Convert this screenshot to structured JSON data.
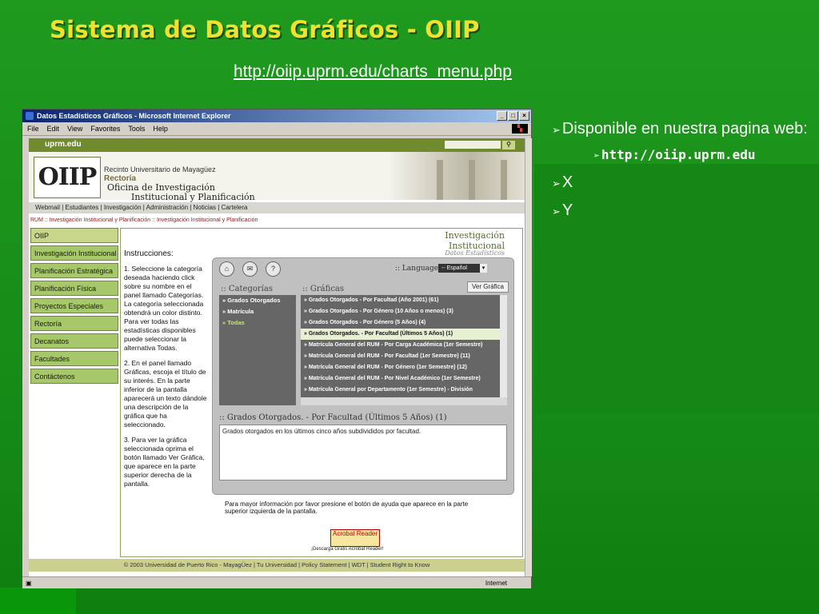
{
  "slide": {
    "title": "Sistema de Datos Gráficos - OIIP",
    "url": "http://oiip.uprm.edu/charts_menu.php",
    "bullets": {
      "item1": "Disponible en nuestra pagina web:",
      "sub1": "http://oiip.uprm.edu",
      "item2": "X",
      "item3": "Y"
    },
    "arrow_glyph": "➢"
  },
  "browser": {
    "window_title": "Datos Estadísticos Gráficos - Microsoft Internet Explorer",
    "menu": [
      "File",
      "Edit",
      "View",
      "Favorites",
      "Tools",
      "Help"
    ],
    "window_buttons": [
      "_",
      "□",
      "×"
    ],
    "status_text": "Internet"
  },
  "site": {
    "topbar_label": "uprm.edu",
    "logo_text": "OIIP",
    "header_line1": "Recinto Universitario de Mayagüez",
    "header_line2": "Rectoría",
    "header_line3": "Oficina de Investigación",
    "header_line4": "Institucional y Planificación",
    "navbar": "Webmail | Estudiantes | Investigación | Administración | Noticias | Cartelera",
    "breadcrumb": "RUM :: Investigación Institucional y Planificación :: Investigación Institucional y Planificación",
    "sidebar_items": [
      "OIIP",
      "Investigación Institucional",
      "Planificación Estratégica",
      "Planificación Física",
      "Proyectos Especiales",
      "Rectoría",
      "Decanatos",
      "Facultades",
      "Contáctenos"
    ],
    "content_header": "Investigación Institucional",
    "content_header_sub": "Datos Estadísticos",
    "instructions_title": "Instrucciones:",
    "instructions": [
      "1. Seleccione la categoría deseada haciendo click sobre su nombre en el panel llamado Categorías. La categoría seleccionada obtendrá un color distinto. Para ver todas las estadísticas disponibles puede seleccionar la alternativa Todas.",
      "2. En el panel llamado Gráficas, escoja el título de su interés. En la parte inferior de la pantalla aparecerá un texto dándole una descripción de la gráfica que ha seleccionado.",
      "3. Para ver la gráfica seleccionada oprima el botón llamado Ver Gráfica, que aparece en la parte superior derecha de la pantalla."
    ],
    "app": {
      "language_label": ":: Language",
      "language_value": "-- Español",
      "view_button": "Ver Gráfica",
      "categories_title": ":: Categorías",
      "graphs_title": ":: Gráficas",
      "categories": [
        "» Grados Otorgados",
        "» Matrícula",
        "» Todas"
      ],
      "graphs": [
        "» Grados Otorgados - Por Facultad (Año 2001) (61)",
        "» Grados Otorgados - Por Género (10 Años o menos) (3)",
        "» Grados Otorgados - Por Género (5 Años) (4)",
        "» Grados Otorgados. - Por Facultad (Últimos 5 Años) (1)",
        "» Matrícula General del RUM - Por Carga Académica (1er Semestre)",
        "» Matrícula General del RUM - Por Facultad (1er Semestre) (11)",
        "» Matrícula General del RUM - Por Género (1er Semestre) (12)",
        "» Matrícula General del RUM - Por Nivel Académico (1er Semestre)",
        "» Matrícula General por Departamento (1er Semestre) - División"
      ],
      "selected_graph_index": 3,
      "description_title": ":: Grados Otorgados. - Por Facultad (Últimos 5 Años) (1)",
      "description": "Grados otorgados en los últimos cinco años subdivididos por facultad."
    },
    "more_info": "Para mayor información por favor presione el botón de ayuda que aparece en la parte superior izquierda de la pantalla.",
    "acrobat_label": "Acrobat Reader",
    "acrobat_link": "¡Descarga Gratis Acrobat Reader!",
    "footer": "© 2003 Universidad de Puerto Rico - MayagÜez | Tu Universidad | Policy Statement | WDT | Student Right to Know"
  }
}
